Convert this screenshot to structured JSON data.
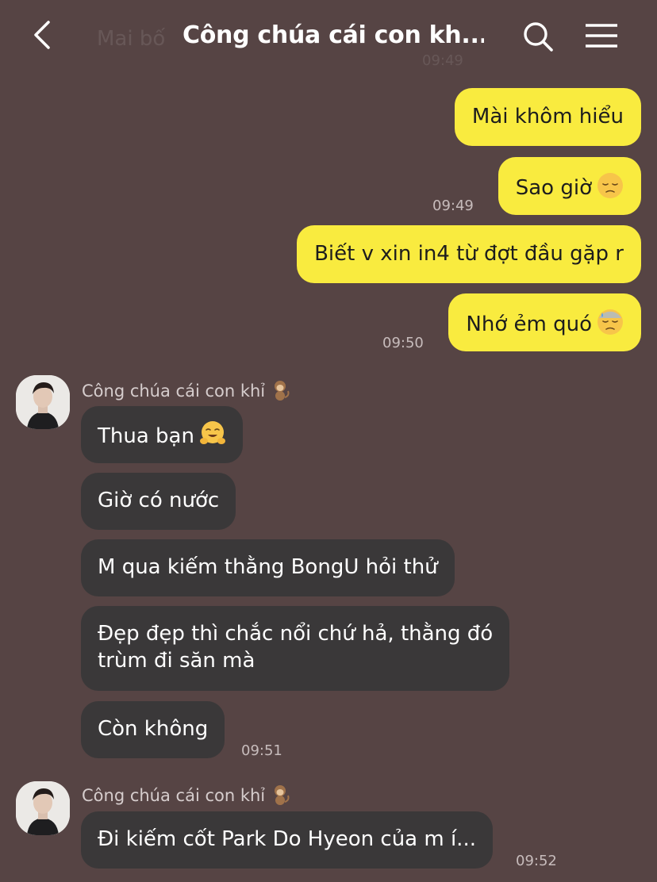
{
  "header": {
    "title": "Công chúa cái con kh...",
    "behind_name": "Mai bố",
    "behind_time": "09:49"
  },
  "outgoing": [
    {
      "text": "Mài khôm hiểu"
    },
    {
      "text": "Sao giờ",
      "emoji": "pensive-face-emoji"
    },
    {
      "text": "Biết v xin in4 từ đợt đầu gặp r"
    },
    {
      "text": "Nhớ ẻm quó",
      "emoji": "downcast-sweat-face-emoji"
    }
  ],
  "outgoing_times": [
    "09:49",
    "09:50"
  ],
  "groups": [
    {
      "sender": "Công chúa cái con khỉ",
      "sender_emoji": "monkey-emoji",
      "messages": [
        {
          "text": "Thua bạn",
          "emoji": "hugging-face-emoji"
        },
        {
          "text": "Giờ có nước"
        },
        {
          "text": "M qua kiếm thằng BongU hỏi thử"
        },
        {
          "lines": [
            "Đẹp đẹp thì chắc nổi chứ hả, thằng đó",
            "trùm đi săn mà"
          ]
        },
        {
          "text": "Còn không"
        }
      ],
      "time": "09:51"
    },
    {
      "sender": "Công chúa cái con khỉ",
      "sender_emoji": "monkey-emoji",
      "messages": [
        {
          "text": "Đi kiếm cốt Park Do Hyeon của m í..."
        }
      ],
      "time": "09:52"
    }
  ],
  "colors": {
    "background": "#564444",
    "outgoing_bubble": "#f9eb3f",
    "incoming_bubble": "#3a3839"
  }
}
